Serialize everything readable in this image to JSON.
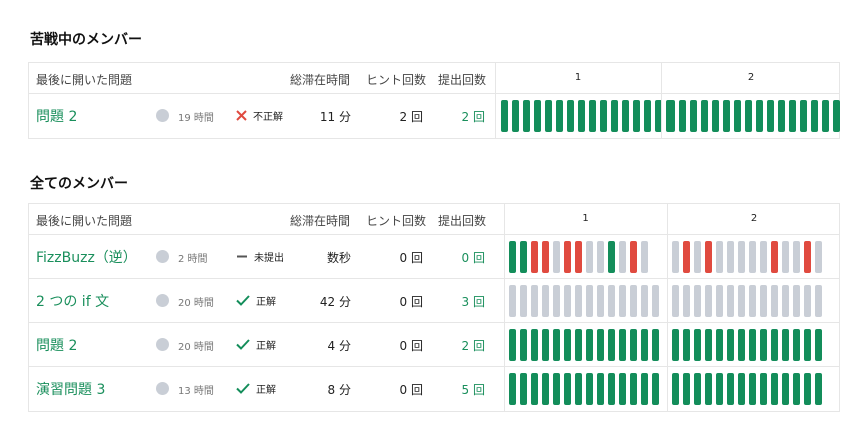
{
  "struggling": {
    "title": "苦戦中のメンバー",
    "header": {
      "last": "最後に開いた問題",
      "time": "総滞在時間",
      "hints": "ヒント回数",
      "subs": "提出回数",
      "p1": "1",
      "p2": "2"
    },
    "rows": [
      {
        "problem": "問題 2",
        "elapsed": "19 時間",
        "status": "不正解",
        "status_icon": "cross-icon",
        "time": "11 分",
        "hints": "2 回",
        "subs": "2 回",
        "bars1": "gggggggggggggggg",
        "bars2": "gggggggggggggggg"
      }
    ]
  },
  "all": {
    "title": "全てのメンバー",
    "header": {
      "last": "最後に開いた問題",
      "time": "総滞在時間",
      "hints": "ヒント回数",
      "subs": "提出回数",
      "p1": "1",
      "p2": "2"
    },
    "rows": [
      {
        "problem": "FizzBuzz（逆）",
        "elapsed": "2 時間",
        "status": "未提出",
        "status_icon": "dash-icon",
        "time": "数秒",
        "hints": "0 回",
        "subs": "0 回",
        "bars1": "ggrrnrrnngnrn",
        "bars2": "nrnrnnnnnrnnrn"
      },
      {
        "problem": "2 つの if 文",
        "elapsed": "20 時間",
        "status": "正解",
        "status_icon": "check-icon",
        "time": "42 分",
        "hints": "0 回",
        "subs": "3 回",
        "bars1": "nnnnnnnnnnnnnn",
        "bars2": "nnnnnnnnnnnnnn"
      },
      {
        "problem": "問題 2",
        "elapsed": "20 時間",
        "status": "正解",
        "status_icon": "check-icon",
        "time": "4 分",
        "hints": "0 回",
        "subs": "2 回",
        "bars1": "gggggggggggggg",
        "bars2": "gggggggggggggg"
      },
      {
        "problem": "演習問題 3",
        "elapsed": "13 時間",
        "status": "正解",
        "status_icon": "check-icon",
        "time": "8 分",
        "hints": "0 回",
        "subs": "5 回",
        "bars1": "gggggggggggggg",
        "bars2": "gggggggggggggg"
      }
    ]
  },
  "colors": {
    "accent": "#1a8f5c",
    "bar_green": "#138d5a",
    "bar_red": "#e04a3f",
    "bar_gray": "#c9ced6",
    "cross": "#e04a3f",
    "check": "#138d5a"
  }
}
